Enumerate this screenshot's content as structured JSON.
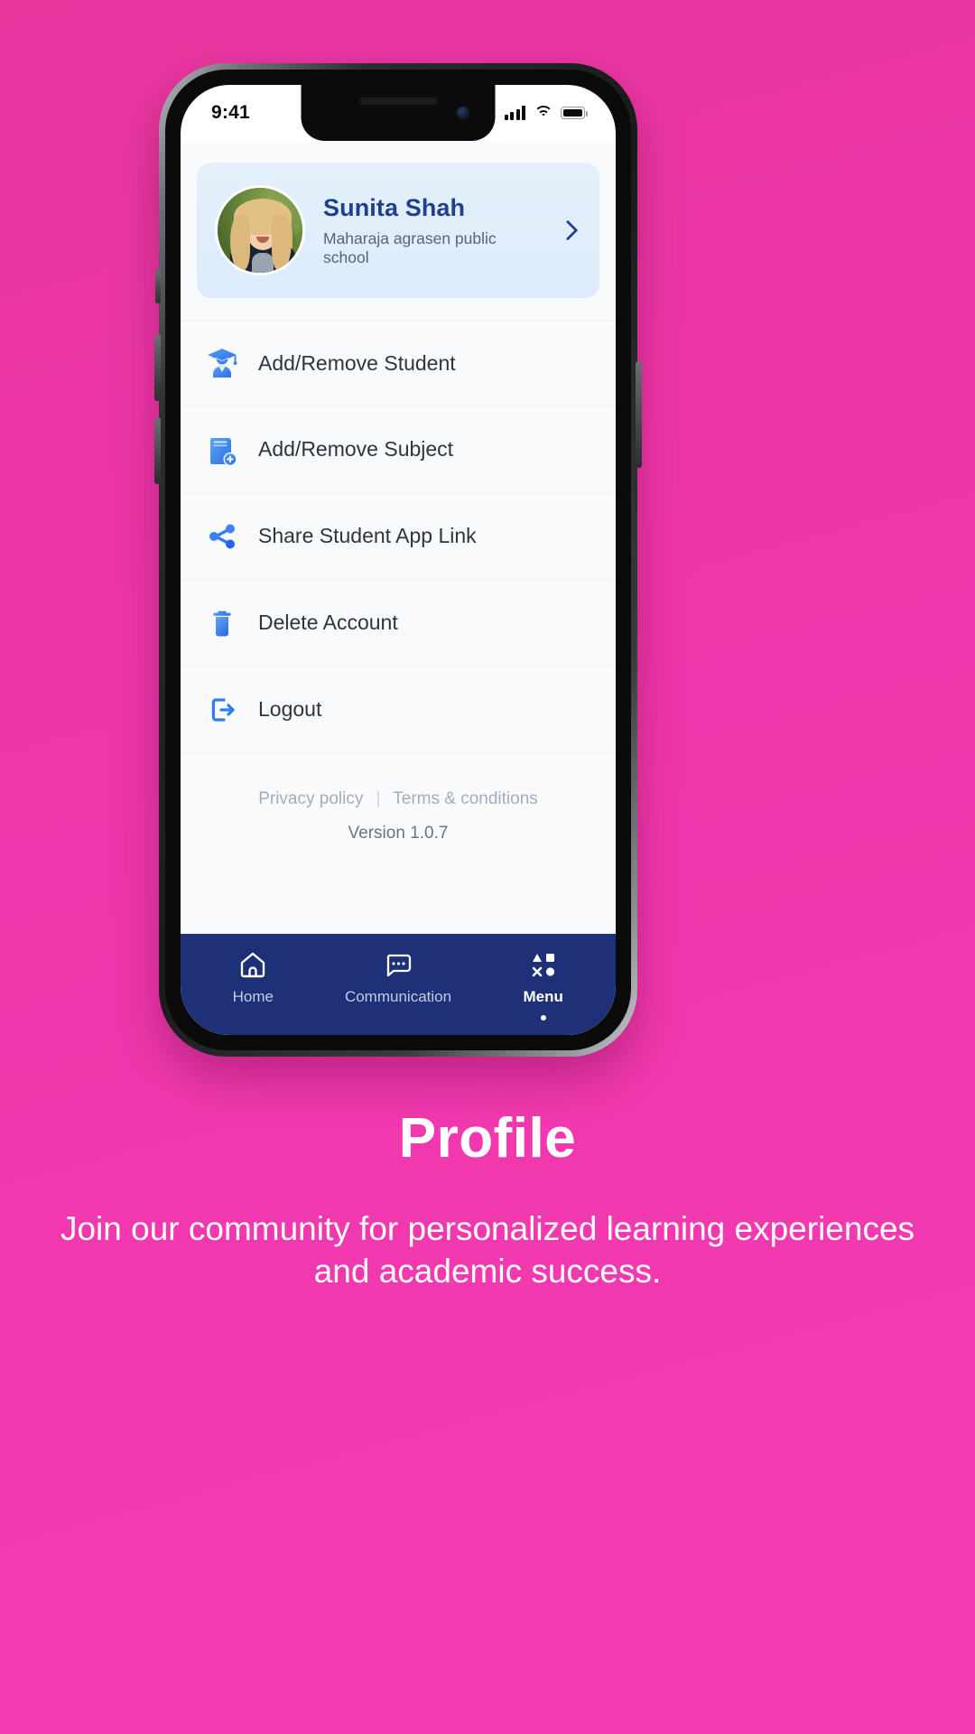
{
  "statusbar": {
    "time": "9:41",
    "signal_icon": "cellular-signal-icon",
    "wifi_icon": "wifi-icon",
    "battery_icon": "battery-icon"
  },
  "profile": {
    "name": "Sunita Shah",
    "school": "Maharaja agrasen public school",
    "avatar_icon": "user-avatar-photo",
    "chevron_icon": "chevron-right-icon"
  },
  "menu": {
    "items": [
      {
        "label": "Add/Remove Student",
        "icon": "student-graduate-icon"
      },
      {
        "label": "Add/Remove Subject",
        "icon": "book-add-icon"
      },
      {
        "label": "Share Student App Link",
        "icon": "share-icon"
      },
      {
        "label": "Delete Account",
        "icon": "trash-icon"
      },
      {
        "label": "Logout",
        "icon": "logout-icon"
      }
    ]
  },
  "footer": {
    "privacy_label": "Privacy policy",
    "separator": "|",
    "terms_label": "Terms & conditions",
    "version": "Version 1.0.7"
  },
  "bottom_nav": {
    "items": [
      {
        "label": "Home",
        "icon": "home-icon",
        "active": false
      },
      {
        "label": "Communication",
        "icon": "chat-bubble-icon",
        "active": false
      },
      {
        "label": "Menu",
        "icon": "grid-shapes-menu-icon",
        "active": true
      }
    ]
  },
  "caption": {
    "title": "Profile",
    "subtitle": "Join our community for personalized learning experiences and academic success."
  },
  "colors": {
    "background": "#ec37b0",
    "accent_blue": "#2f7df5",
    "navy": "#1e3077",
    "name_blue": "#1f3f8f",
    "card_blue": "#e0edfa"
  }
}
